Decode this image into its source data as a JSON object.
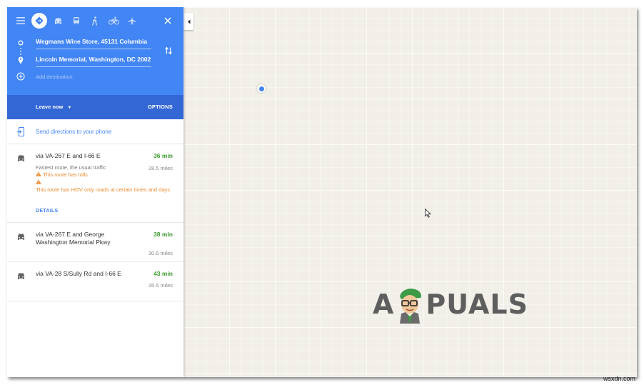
{
  "directions": {
    "from": "Wegmans Wine Store, 45131 Columbia",
    "to": "Lincoln Memorial, Washington, DC 2002",
    "add_destination": "Add destination",
    "leave_label": "Leave now",
    "options_label": "OPTIONS",
    "send_label": "Send directions to your phone",
    "modes": [
      "directions-icon",
      "car-icon",
      "train-icon",
      "walk-icon",
      "bike-icon",
      "flight-icon"
    ]
  },
  "routes": [
    {
      "name": "via VA-267 E and I-66 E",
      "time": "36 min",
      "distance": "28.5 miles",
      "desc": "Fastest route, the usual traffic",
      "warnings": [
        "This route has tolls.",
        "This route has HOV only roads at certain times and days"
      ],
      "details": "DETAILS"
    },
    {
      "name": "via VA-267 E and George Washington Memorial Pkwy",
      "time": "38 min",
      "distance": "30.6 miles"
    },
    {
      "name": "via VA-28 S/Sully Rd and I-66 E",
      "time": "43 min",
      "distance": "35.5 miles"
    }
  ],
  "branding": {
    "logo_left": "A",
    "logo_right": "PUALS",
    "watermark": "wsxdn.com"
  },
  "colors": {
    "header": "#4285f4",
    "header_dark": "#3367d6",
    "time_green": "#3c9a2e",
    "warning": "#f0892f",
    "map_bg": "#f2efe9"
  }
}
